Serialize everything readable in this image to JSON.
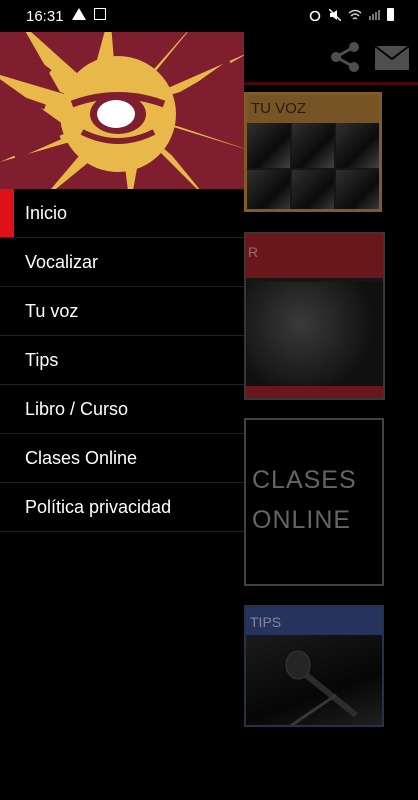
{
  "status_bar": {
    "time": "16:31"
  },
  "drawer": {
    "menu_items": [
      {
        "label": "Inicio",
        "active": true
      },
      {
        "label": "Vocalizar",
        "active": false
      },
      {
        "label": "Tu voz",
        "active": false
      },
      {
        "label": "Tips",
        "active": false
      },
      {
        "label": "Libro / Curso",
        "active": false
      },
      {
        "label": "Clases Online",
        "active": false
      },
      {
        "label": "Política privacidad",
        "active": false
      }
    ],
    "accent_color": "#e01018",
    "header_colors": [
      "#7e1e2e",
      "#e8b94a"
    ]
  },
  "background": {
    "cards": [
      {
        "label": "TU VOZ"
      },
      {
        "label": "R"
      },
      {
        "label_line1": "CLASES",
        "label_line2": "ONLINE"
      },
      {
        "label": "TIPS"
      }
    ],
    "toolbar_icons": [
      "share-icon",
      "mail-icon"
    ]
  }
}
